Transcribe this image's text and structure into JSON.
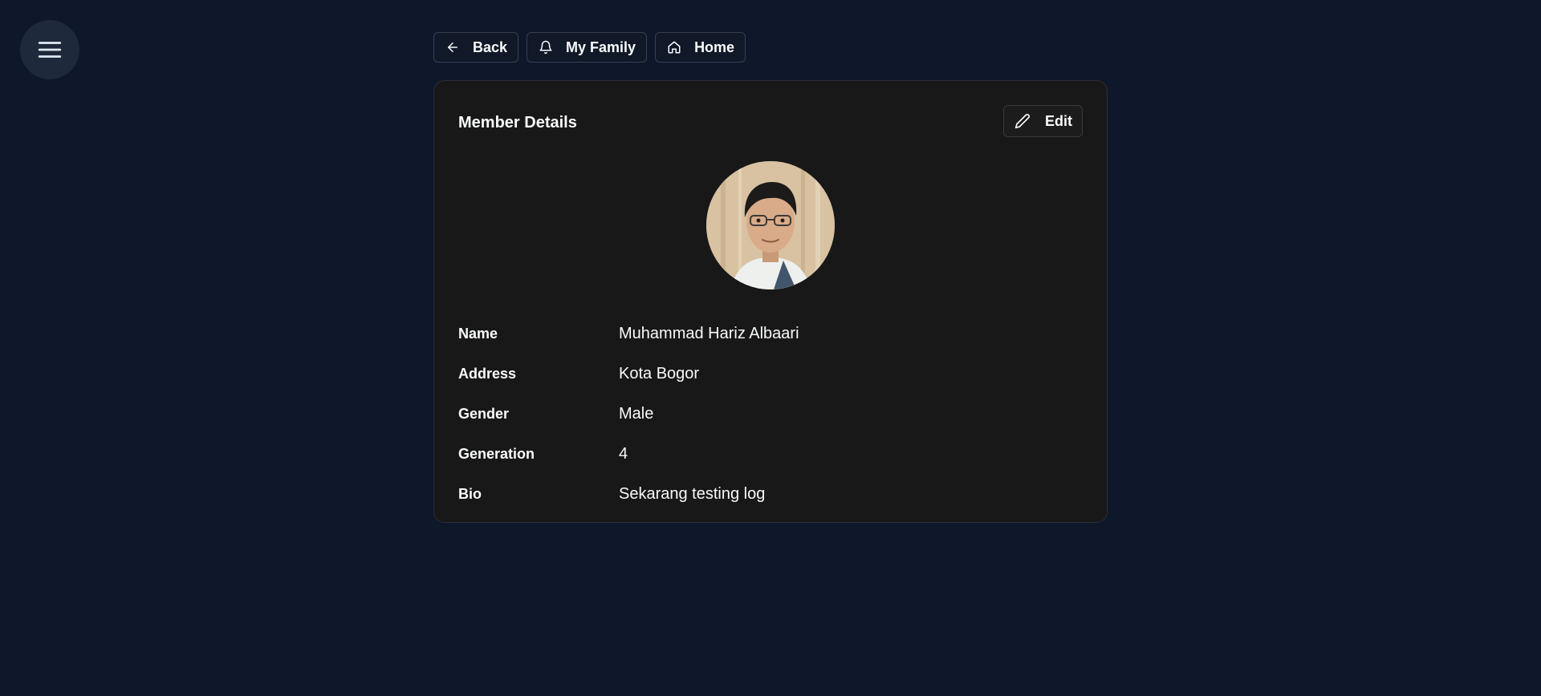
{
  "menu": {
    "icon": "hamburger-icon"
  },
  "nav": {
    "back_label": "Back",
    "family_label": "My Family",
    "home_label": "Home"
  },
  "card": {
    "title": "Member Details",
    "edit_label": "Edit"
  },
  "member": {
    "rows": [
      {
        "label": "Name",
        "value": "Muhammad Hariz Albaari"
      },
      {
        "label": "Address",
        "value": "Kota Bogor"
      },
      {
        "label": "Gender",
        "value": "Male"
      },
      {
        "label": "Generation",
        "value": "4"
      },
      {
        "label": "Bio",
        "value": "Sekarang testing log"
      }
    ]
  },
  "colors": {
    "page_bg": "#0f172a",
    "card_bg": "#181818",
    "button_bg": "#111827",
    "text": "#f8fafc"
  }
}
